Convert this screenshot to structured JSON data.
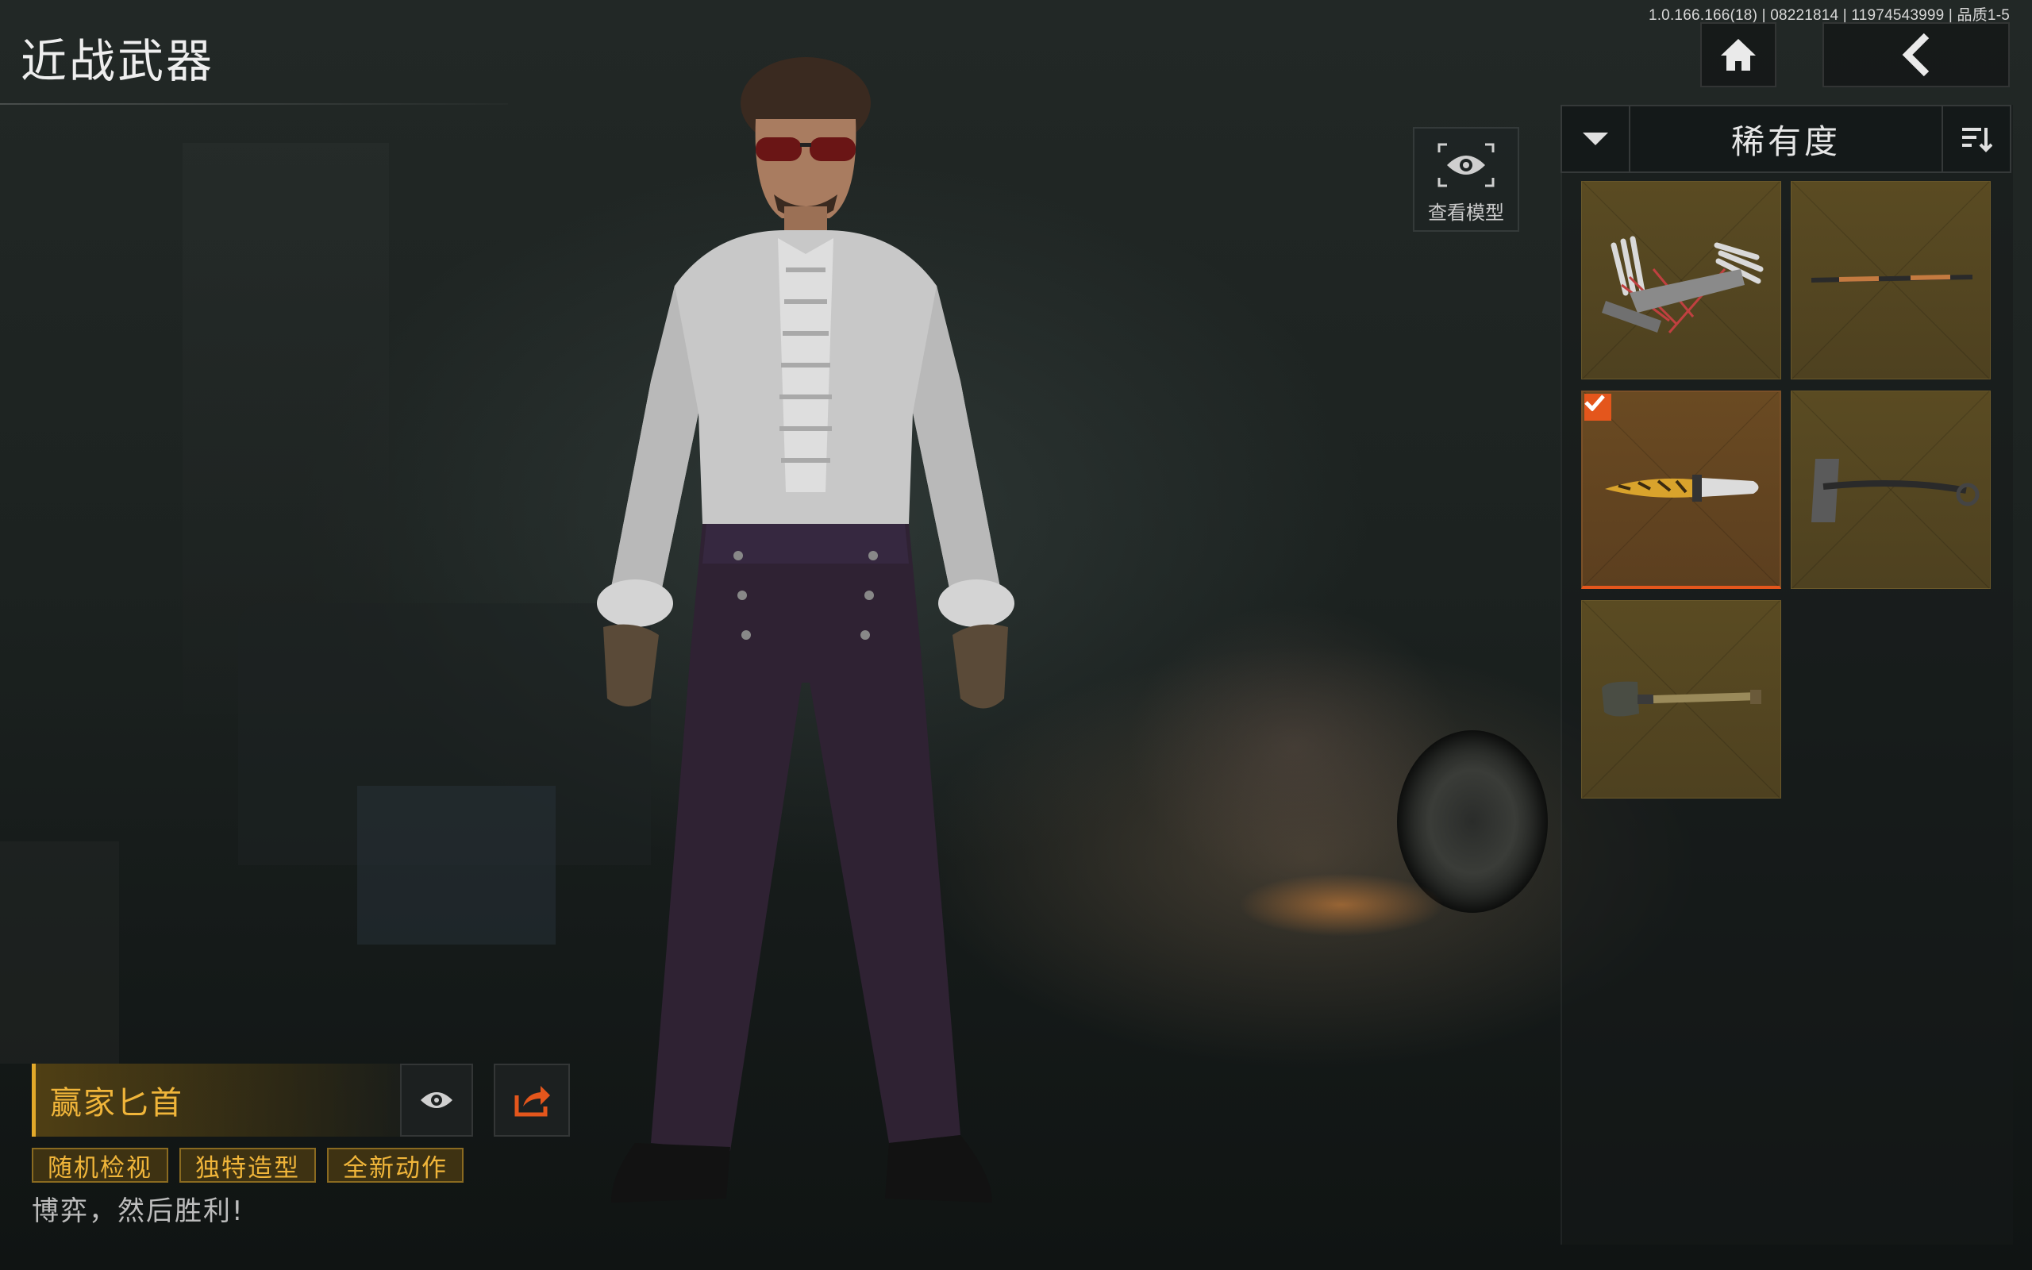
{
  "header": {
    "version": "1.0.166.166(18) | 08221814 | 11974543999 | 品质1-5",
    "title": "近战武器"
  },
  "nav": {
    "home_icon": "home-icon",
    "back_icon": "chevron-left-icon"
  },
  "view_model": {
    "icon": "eye-icon",
    "label": "查看模型"
  },
  "sort": {
    "toggle_icon": "chevron-down-icon",
    "label": "稀有度",
    "order_icon": "sort-icon"
  },
  "items": [
    {
      "name": "claw-gauntlet",
      "icon": "claw-weapon-icon",
      "selected": false
    },
    {
      "name": "rod",
      "icon": "rod-weapon-icon",
      "selected": false
    },
    {
      "name": "gambler-dagger",
      "icon": "dagger-icon",
      "selected": true
    },
    {
      "name": "pickaxe",
      "icon": "pickaxe-icon",
      "selected": false
    },
    {
      "name": "shovel",
      "icon": "shovel-icon",
      "selected": false
    }
  ],
  "selected_item": {
    "name": "赢家匕首",
    "tags": [
      "随机检视",
      "独特造型",
      "全新动作"
    ],
    "description": "博弈，然后胜利!"
  },
  "colors": {
    "accent_orange": "#e4561c",
    "gold_text": "#f0b53a",
    "tile_gold": "#5a4b22"
  }
}
